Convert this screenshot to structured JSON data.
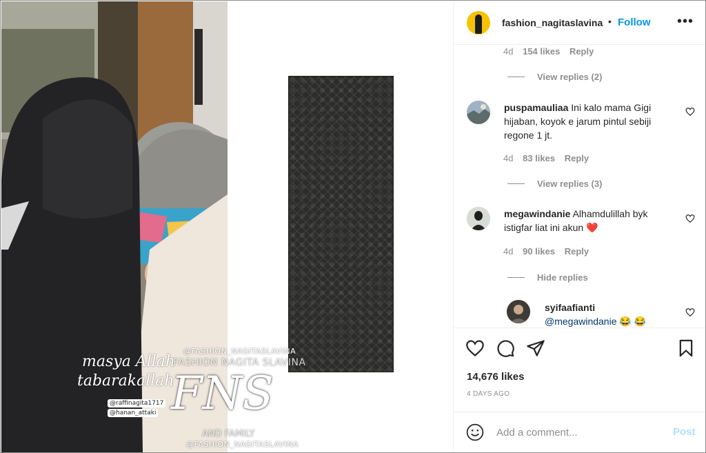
{
  "post": {
    "username": "fashion_nagitaslavina",
    "separator": "•",
    "follow_label": "Follow",
    "more_label": "•••",
    "likes": "14,676 likes",
    "date": "4 DAYS AGO"
  },
  "watermarks": {
    "handle_top": "@FASHION_NAGITASLAVINA",
    "name": "FASHION NAGITA SLAVINA",
    "script_line1": "masya Allah",
    "script_line2": "tabarakallah",
    "monogram": "FNS",
    "tag1": "@raffinagita1717",
    "tag2": "@hanan_attaki",
    "family": "AND FAMILY",
    "handle_bottom": "@FASHION_NAGITASLAVINA"
  },
  "comments": {
    "top_meta": {
      "age": "4d",
      "likes": "154 likes",
      "reply": "Reply"
    },
    "top_view_replies": "View replies (2)",
    "items": [
      {
        "user": "puspamauliaa",
        "text": "Ini kalo mama Gigi hijaban, koyok e jarum pintul sebiji regone 1 jt.",
        "age": "4d",
        "likes": "83 likes",
        "reply": "Reply",
        "view_replies": "View replies (3)"
      },
      {
        "user": "megawindanie",
        "text": "Alhamdulillah byk istigfar liat ini akun",
        "emoji": "❤️",
        "age": "4d",
        "likes": "90 likes",
        "reply": "Reply",
        "view_replies": "Hide replies"
      },
      {
        "user": "syifaafianti",
        "mention": "@megawindanie",
        "emoji": "😂 😂"
      }
    ]
  },
  "add_comment": {
    "placeholder": "Add a comment...",
    "post_label": "Post"
  },
  "colors": {
    "accent": "#0095f6",
    "post_disabled": "#b2dffc",
    "heart": "#ed4956"
  }
}
